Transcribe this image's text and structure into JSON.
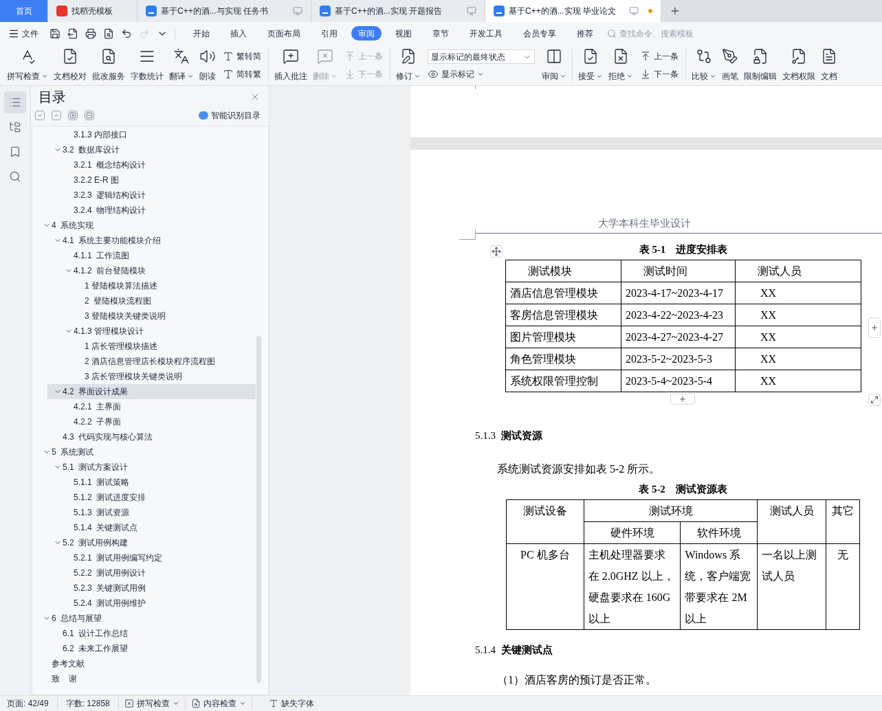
{
  "tabs": [
    {
      "kind": "home",
      "label": "首页",
      "selected": false,
      "unsaved": false
    },
    {
      "kind": "template",
      "label": "找稻壳模板",
      "selected": false,
      "unsaved": false
    },
    {
      "kind": "doc",
      "label": "基于C++的酒...与实现 任务书",
      "selected": false,
      "unsaved": false
    },
    {
      "kind": "doc",
      "label": "基于C++的酒...实现 开题报告",
      "selected": false,
      "unsaved": false
    },
    {
      "kind": "doc",
      "label": "基于C++的酒...实现 毕业论文",
      "selected": true,
      "unsaved": true
    }
  ],
  "menu": {
    "file_label": "文件",
    "tabs": [
      {
        "label": "开始",
        "selected": false
      },
      {
        "label": "插入",
        "selected": false
      },
      {
        "label": "页面布局",
        "selected": false
      },
      {
        "label": "引用",
        "selected": false
      },
      {
        "label": "审阅",
        "selected": true
      },
      {
        "label": "视图",
        "selected": false
      },
      {
        "label": "章节",
        "selected": false
      },
      {
        "label": "开发工具",
        "selected": false
      },
      {
        "label": "会员专享",
        "selected": false
      },
      {
        "label": "推荐",
        "selected": false
      }
    ],
    "search": {
      "placeholder": "查找命令、搜索模板"
    }
  },
  "ribbon": [
    {
      "kind": "large",
      "label": "拼写检查",
      "menu": true,
      "disabled": false
    },
    {
      "kind": "large",
      "label": "文档校对",
      "menu": false,
      "disabled": false
    },
    {
      "kind": "large",
      "label": "批改服务",
      "menu": false,
      "disabled": false
    },
    {
      "kind": "large",
      "label": "字数统计",
      "menu": false,
      "disabled": false
    },
    {
      "kind": "large",
      "label": "翻译",
      "menu": true,
      "disabled": false
    },
    {
      "kind": "large",
      "label": "朗读",
      "menu": false,
      "disabled": false
    },
    {
      "kind": "stack",
      "items": [
        {
          "label": "繁转简",
          "disabled": false
        },
        {
          "label": "简转繁",
          "disabled": false
        }
      ]
    },
    {
      "kind": "divider"
    },
    {
      "kind": "large",
      "label": "插入批注",
      "menu": false,
      "disabled": false
    },
    {
      "kind": "large",
      "label": "删除",
      "menu": true,
      "disabled": true
    },
    {
      "kind": "stack",
      "items": [
        {
          "label": "上一条",
          "disabled": true
        },
        {
          "label": "下一条",
          "disabled": true
        }
      ]
    },
    {
      "kind": "divider"
    },
    {
      "kind": "large",
      "label": "修订",
      "menu": true,
      "disabled": false
    },
    {
      "kind": "select",
      "value": "显示标记的最终状态",
      "button": {
        "label": "显示标记",
        "menu": true
      }
    },
    {
      "kind": "large",
      "label": "审阅",
      "menu": true,
      "disabled": false
    },
    {
      "kind": "divider"
    },
    {
      "kind": "large",
      "label": "接受",
      "menu": true,
      "disabled": false
    },
    {
      "kind": "large",
      "label": "拒绝",
      "menu": true,
      "disabled": false
    },
    {
      "kind": "stack",
      "items": [
        {
          "label": "上一条",
          "disabled": false
        },
        {
          "label": "下一条",
          "disabled": false
        }
      ]
    },
    {
      "kind": "divider"
    },
    {
      "kind": "large",
      "label": "比较",
      "menu": true,
      "disabled": false
    },
    {
      "kind": "large",
      "label": "画笔",
      "menu": false,
      "disabled": false
    },
    {
      "kind": "large",
      "label": "限制编辑",
      "menu": false,
      "disabled": false
    },
    {
      "kind": "large",
      "label": "文档权限",
      "menu": false,
      "disabled": false
    },
    {
      "kind": "large",
      "label": "文档",
      "menu": false,
      "disabled": false
    }
  ],
  "side_strip": [
    {
      "selected": true
    },
    {
      "selected": false
    },
    {
      "selected": false
    },
    {
      "selected": false
    }
  ],
  "toc": {
    "title": "目录",
    "smart_label": "智能识别目录",
    "items": [
      {
        "children": [
          {
            "children": [
              {
                "label": "3.1.3 内部接口",
                "selected": false
              }
            ]
          },
          {
            "label": "3.2  数据库设计",
            "selected": false,
            "expanded": true,
            "children": [
              {
                "label": "3.2.1  概念结构设计",
                "selected": false
              },
              {
                "label": "3.2.2 E-R 图",
                "selected": false
              },
              {
                "label": "3.2.3  逻辑结构设计",
                "selected": false
              },
              {
                "label": "3.2.4  物理结构设计",
                "selected": false
              }
            ]
          }
        ]
      },
      {
        "label": "4  系统实现",
        "selected": false,
        "expanded": true,
        "children": [
          {
            "label": "4.1  系统主要功能模块介绍",
            "selected": false,
            "expanded": true,
            "children": [
              {
                "label": "4.1.1  工作流图",
                "selected": false
              },
              {
                "label": "4.1.2  前台登陆模块",
                "selected": false,
                "expanded": true,
                "children": [
                  {
                    "label": "1 登陆模块算法描述",
                    "selected": false
                  },
                  {
                    "label": "2  登陆模块流程图",
                    "selected": false
                  },
                  {
                    "label": "3 登陆模块关键类说明",
                    "selected": false
                  }
                ]
              },
              {
                "label": "4.1.3 管理模块设计",
                "selected": false,
                "expanded": true,
                "children": [
                  {
                    "label": "1 店长管理模块描述",
                    "selected": false
                  },
                  {
                    "label": "2 酒店信息管理店长模块程序流程图",
                    "selected": false
                  },
                  {
                    "label": "3 店长管理模块关键类说明",
                    "selected": false
                  }
                ]
              }
            ]
          },
          {
            "label": "4.2  界面设计成果",
            "selected": true,
            "expanded": true,
            "children": [
              {
                "label": "4.2.1  主界面",
                "selected": false
              },
              {
                "label": "4.2.2  子界面",
                "selected": false
              }
            ]
          },
          {
            "label": "4.3  代码实现与核心算法",
            "selected": false
          }
        ]
      },
      {
        "label": "5  系统测试",
        "selected": false,
        "expanded": true,
        "children": [
          {
            "label": "5.1  测试方案设计",
            "selected": false,
            "expanded": true,
            "children": [
              {
                "label": "5.1.1  测试策略",
                "selected": false
              },
              {
                "label": "5.1.2  测试进度安排",
                "selected": false
              },
              {
                "label": "5.1.3  测试资源",
                "selected": false
              },
              {
                "label": "5.1.4  关键测试点",
                "selected": false
              }
            ]
          },
          {
            "label": "5.2  测试用例构建",
            "selected": false,
            "expanded": true,
            "children": [
              {
                "label": "5.2.1  测试用例编写约定",
                "selected": false
              },
              {
                "label": "5.2.2  测试用例设计",
                "selected": false
              },
              {
                "label": "5.2.3  关键测试用例",
                "selected": false
              },
              {
                "label": "5.2.4  测试用例维护",
                "selected": false
              }
            ]
          }
        ]
      },
      {
        "label": "6  总结与展望",
        "selected": false,
        "expanded": true,
        "children": [
          {
            "label": "6.1  设计工作总结",
            "selected": false
          },
          {
            "label": "6.2  未来工作展望",
            "selected": false
          }
        ]
      },
      {
        "label": "参考文献",
        "selected": false
      },
      {
        "label": "致    谢",
        "selected": false
      }
    ]
  },
  "document": {
    "page_header": "大学本科生毕业设计",
    "schedule_table": {
      "caption": "表 5-1    进度安排表",
      "columns": [
        "测试模块",
        "测试时间",
        "测试人员"
      ],
      "rows": [
        [
          "酒店信息管理模块",
          "2023-4-17~2023-4-17",
          "XX"
        ],
        [
          "客房信息管理模块",
          "2023-4-22~2023-4-23",
          "XX"
        ],
        [
          "图片管理模块",
          "2023-4-27~2023-4-27",
          "XX"
        ],
        [
          "角色管理模块",
          "2023-5-2~2023-5-3",
          "XX"
        ],
        [
          "系统权限管理控制",
          "2023-5-4~2023-5-4",
          "XX"
        ]
      ]
    },
    "heading_1": {
      "number": "5.1.3",
      "title": "测试资源"
    },
    "paragraph_1": "系统测试资源安排如表 5-2 所示。",
    "resource_table": {
      "caption": "表 5-2    测试资源表",
      "header_top": [
        "测试设备",
        "测试环境",
        "测试人员",
        "其它"
      ],
      "header_sub": [
        "硬件环境",
        "软件环境"
      ],
      "rows": [
        [
          "PC 机多台",
          "主机处理器要求在 2.0GHZ 以上，硬盘要求在 160G 以上",
          "Windows 系统，客户端宽带要求在 2M 以上",
          "一名以上测试人员",
          "无"
        ]
      ]
    },
    "heading_2": {
      "number": "5.1.4",
      "title": "关键测试点"
    },
    "paragraph_2": "（1）酒店客房的预订是否正常。"
  },
  "status_bar": {
    "page": "页面: 42/49",
    "word_count": "字数: 12858",
    "buttons": [
      {
        "label": "拼写检查",
        "menu": true
      },
      {
        "label": "内容检查",
        "menu": true
      },
      {
        "label": "缺失字体",
        "menu": false
      }
    ]
  }
}
